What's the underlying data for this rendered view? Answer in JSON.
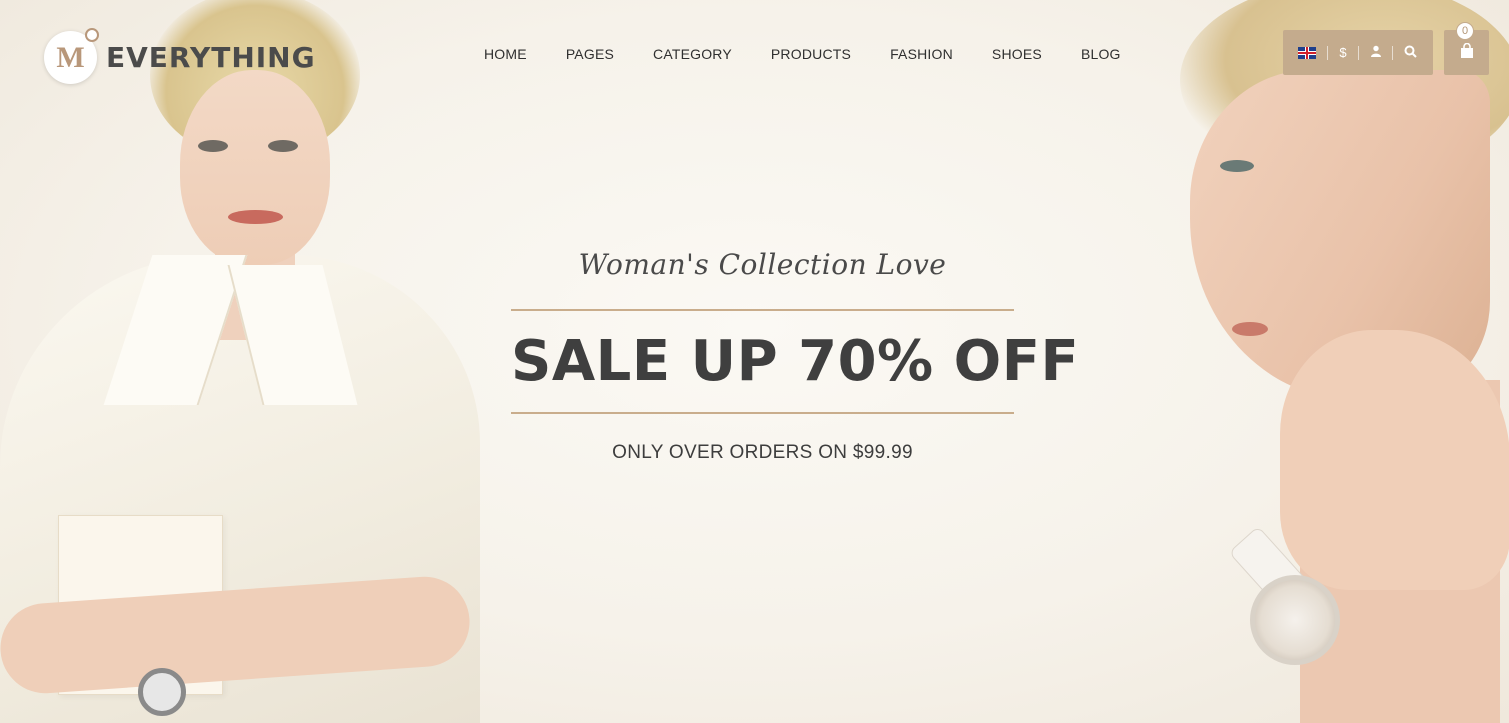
{
  "brand": {
    "name": "EVERYTHING",
    "logo_icon": "m-logo-icon"
  },
  "nav": {
    "items": [
      {
        "label": "HOME"
      },
      {
        "label": "PAGES"
      },
      {
        "label": "CATEGORY"
      },
      {
        "label": "PRODUCTS"
      },
      {
        "label": "FASHION"
      },
      {
        "label": "SHOES"
      },
      {
        "label": "BLOG"
      }
    ]
  },
  "toolbar": {
    "language_icon": "uk-flag-icon",
    "currency": "$",
    "account_icon": "user-icon",
    "search_icon": "search-icon"
  },
  "cart": {
    "count": "0",
    "icon": "shopping-bag-icon"
  },
  "hero": {
    "tagline": "Woman's Collection Love",
    "headline": "SALE UP 70% OFF",
    "subline": "ONLY OVER ORDERS ON $99.99"
  },
  "colors": {
    "accent": "#c4ab8d",
    "background": "#f6f2ea",
    "text_dark": "#3f3f3f"
  }
}
